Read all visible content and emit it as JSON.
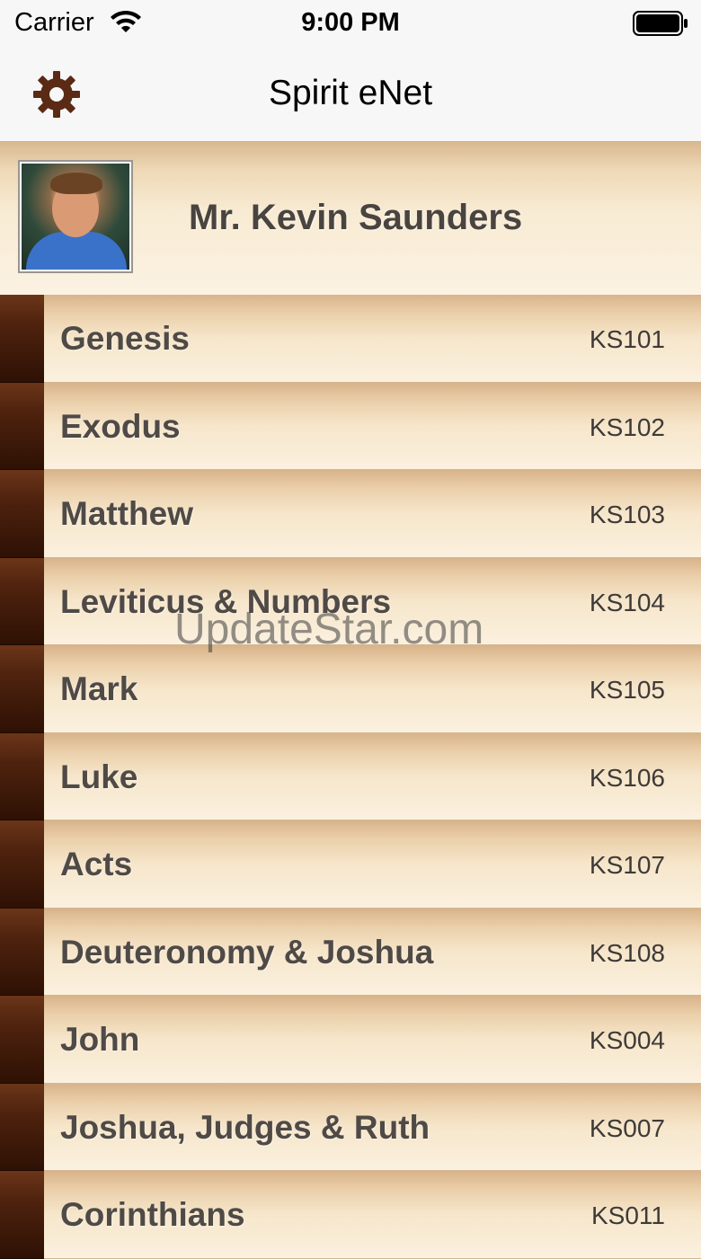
{
  "status_bar": {
    "carrier": "Carrier",
    "time": "9:00 PM",
    "wifi_icon": "wifi-icon",
    "battery_icon": "battery-icon"
  },
  "nav_bar": {
    "title": "Spirit eNet",
    "settings_icon": "gear-icon",
    "accent_color": "#5a2a14"
  },
  "profile": {
    "name": "Mr. Kevin Saunders"
  },
  "courses": [
    {
      "title": "Genesis",
      "code": "KS101"
    },
    {
      "title": "Exodus",
      "code": "KS102"
    },
    {
      "title": "Matthew",
      "code": "KS103"
    },
    {
      "title": "Leviticus & Numbers",
      "code": "KS104"
    },
    {
      "title": "Mark",
      "code": "KS105"
    },
    {
      "title": "Luke",
      "code": "KS106"
    },
    {
      "title": "Acts",
      "code": "KS107"
    },
    {
      "title": "Deuteronomy & Joshua",
      "code": "KS108"
    },
    {
      "title": "John",
      "code": "KS004"
    },
    {
      "title": "Joshua, Judges & Ruth",
      "code": "KS007"
    },
    {
      "title": "Corinthians",
      "code": "KS011"
    }
  ],
  "watermark": "UpdateStar.com",
  "colors": {
    "spine": "#4e220e",
    "row_gradient_top": "#d8b38a",
    "row_gradient_bottom": "#fbf1df",
    "text": "#4f4a46"
  }
}
